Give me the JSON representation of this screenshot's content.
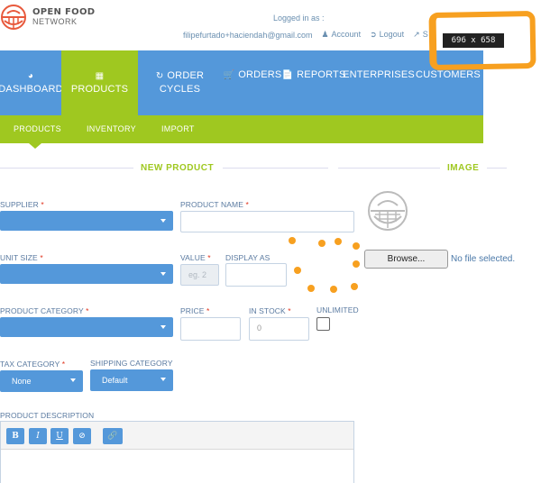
{
  "brand": {
    "line1": "OPEN FOOD",
    "line2": "NETWORK"
  },
  "user": {
    "logged_in_as": "Logged in as :",
    "email": "filipefurtado+haciendah@gmail.com",
    "account": "Account",
    "logout": "Logout",
    "store": "S"
  },
  "overlay": {
    "dimensions": "696 x 658",
    "highlight_color": "#f7a020"
  },
  "nav": {
    "dashboard": "DASHBOARD",
    "products": "PRODUCTS",
    "order_cycles_1": "ORDER",
    "order_cycles_2": "CYCLES",
    "orders": "ORDERS",
    "reports": "REPORTS",
    "enterprises": "ENTERPRISES",
    "customers": "CUSTOMERS"
  },
  "subnav": {
    "products": "PRODUCTS",
    "inventory": "INVENTORY",
    "import": "IMPORT"
  },
  "sections": {
    "new_product": "NEW PRODUCT",
    "image": "IMAGE"
  },
  "form": {
    "supplier": "SUPPLIER",
    "product_name": "PRODUCT NAME",
    "unit_size": "UNIT SIZE",
    "value": "VALUE",
    "value_placeholder": "eg. 2",
    "display_as": "DISPLAY AS",
    "product_category": "PRODUCT CATEGORY",
    "price": "PRICE",
    "in_stock": "IN STOCK",
    "in_stock_value": "0",
    "unlimited": "UNLIMITED",
    "tax_category": "TAX CATEGORY",
    "tax_category_value": "None",
    "shipping_category": "SHIPPING CATEGORY",
    "shipping_category_value": "Default",
    "product_description": "PRODUCT DESCRIPTION",
    "required_mark": "*"
  },
  "image": {
    "browse": "Browse...",
    "no_file": "No file selected."
  },
  "editor": {
    "bold": "B",
    "italic": "I",
    "underline": "U",
    "clear": "⊘",
    "link": "🔗"
  },
  "colors": {
    "primary": "#5498da",
    "accent": "#9fc820",
    "required": "#e0341e"
  }
}
